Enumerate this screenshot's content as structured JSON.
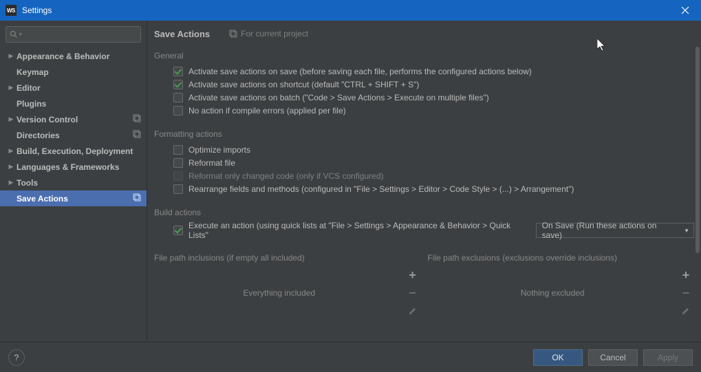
{
  "window": {
    "app_abbr": "WS",
    "title": "Settings"
  },
  "sidebar": {
    "search_placeholder": "",
    "items": [
      {
        "label": "Appearance & Behavior",
        "expandable": true
      },
      {
        "label": "Keymap",
        "expandable": false
      },
      {
        "label": "Editor",
        "expandable": true
      },
      {
        "label": "Plugins",
        "expandable": false
      },
      {
        "label": "Version Control",
        "expandable": true,
        "scope": true
      },
      {
        "label": "Directories",
        "expandable": false,
        "scope": true
      },
      {
        "label": "Build, Execution, Deployment",
        "expandable": true
      },
      {
        "label": "Languages & Frameworks",
        "expandable": true
      },
      {
        "label": "Tools",
        "expandable": true
      },
      {
        "label": "Save Actions",
        "expandable": false,
        "scope": true,
        "selected": true
      }
    ]
  },
  "main": {
    "breadcrumb": "Save Actions",
    "scope_label": "For current project",
    "sections": {
      "general": {
        "title": "General",
        "items": [
          {
            "checked": true,
            "label": "Activate save actions on save (before saving each file, performs the configured actions below)"
          },
          {
            "checked": true,
            "label": "Activate save actions on shortcut (default \"CTRL + SHIFT + S\")"
          },
          {
            "checked": false,
            "label": "Activate save actions on batch (\"Code > Save Actions > Execute on multiple files\")"
          },
          {
            "checked": false,
            "label": "No action if compile errors (applied per file)"
          }
        ]
      },
      "formatting": {
        "title": "Formatting actions",
        "items": [
          {
            "checked": false,
            "label": "Optimize imports"
          },
          {
            "checked": false,
            "label": "Reformat file"
          },
          {
            "checked": false,
            "disabled": true,
            "label": "Reformat only changed code (only if VCS configured)"
          },
          {
            "checked": false,
            "label": "Rearrange fields and methods (configured in \"File > Settings > Editor > Code Style > (...) > Arrangement\")"
          }
        ]
      },
      "build": {
        "title": "Build actions",
        "execute": {
          "checked": true,
          "label": "Execute an action (using quick lists at \"File > Settings > Appearance & Behavior > Quick Lists\"",
          "select_value": "On Save (Run these actions on save)"
        }
      },
      "paths": {
        "inclusions_label": "File path inclusions (if empty all included)",
        "inclusions_empty": "Everything included",
        "exclusions_label": "File path exclusions (exclusions override inclusions)",
        "exclusions_empty": "Nothing excluded"
      }
    }
  },
  "footer": {
    "help": "?",
    "ok": "OK",
    "cancel": "Cancel",
    "apply": "Apply"
  }
}
